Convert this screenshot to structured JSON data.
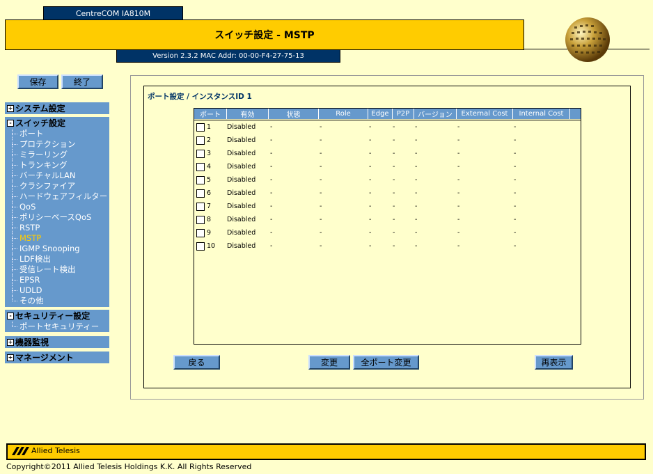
{
  "header": {
    "device_name": "CentreCOM IA810M",
    "title": "スイッチ設定 - MSTP",
    "version_info": "Version 2.3.2 MAC Addr: 00-00-F4-27-75-13"
  },
  "toolbar": {
    "save_label": "保存",
    "exit_label": "終了"
  },
  "sidebar": {
    "system": {
      "label": "システム設定",
      "toggle": "+"
    },
    "switch": {
      "label": "スイッチ設定",
      "toggle": "-",
      "items": [
        "ポート",
        "プロテクション",
        "ミラーリング",
        "トランキング",
        "バーチャルLAN",
        "クラシファイア",
        "ハードウェアフィルター",
        "QoS",
        "ポリシーベースQoS",
        "RSTP",
        "MSTP",
        "IGMP Snooping",
        "LDF検出",
        "受信レート検出",
        "EPSR",
        "UDLD",
        "その他"
      ],
      "active_index": 10
    },
    "security": {
      "label": "セキュリティー設定",
      "toggle": "-",
      "items": [
        "ポートセキュリティー"
      ]
    },
    "monitor": {
      "label": "機器監視",
      "toggle": "+"
    },
    "management": {
      "label": "マネージメント",
      "toggle": "+"
    }
  },
  "main": {
    "section_title": "ポート設定 / インスタンスID 1",
    "columns": [
      "ポート",
      "有効",
      "状態",
      "Role",
      "Edge",
      "P2P",
      "バージョン",
      "External Cost",
      "Internal Cost"
    ],
    "rows": [
      {
        "port": "1",
        "enabled": "Disabled",
        "state": "-",
        "role": "-",
        "edge": "-",
        "p2p": "-",
        "version": "-",
        "ext": "-",
        "int": "-"
      },
      {
        "port": "2",
        "enabled": "Disabled",
        "state": "-",
        "role": "-",
        "edge": "-",
        "p2p": "-",
        "version": "-",
        "ext": "-",
        "int": "-"
      },
      {
        "port": "3",
        "enabled": "Disabled",
        "state": "-",
        "role": "-",
        "edge": "-",
        "p2p": "-",
        "version": "-",
        "ext": "-",
        "int": "-"
      },
      {
        "port": "4",
        "enabled": "Disabled",
        "state": "-",
        "role": "-",
        "edge": "-",
        "p2p": "-",
        "version": "-",
        "ext": "-",
        "int": "-"
      },
      {
        "port": "5",
        "enabled": "Disabled",
        "state": "-",
        "role": "-",
        "edge": "-",
        "p2p": "-",
        "version": "-",
        "ext": "-",
        "int": "-"
      },
      {
        "port": "6",
        "enabled": "Disabled",
        "state": "-",
        "role": "-",
        "edge": "-",
        "p2p": "-",
        "version": "-",
        "ext": "-",
        "int": "-"
      },
      {
        "port": "7",
        "enabled": "Disabled",
        "state": "-",
        "role": "-",
        "edge": "-",
        "p2p": "-",
        "version": "-",
        "ext": "-",
        "int": "-"
      },
      {
        "port": "8",
        "enabled": "Disabled",
        "state": "-",
        "role": "-",
        "edge": "-",
        "p2p": "-",
        "version": "-",
        "ext": "-",
        "int": "-"
      },
      {
        "port": "9",
        "enabled": "Disabled",
        "state": "-",
        "role": "-",
        "edge": "-",
        "p2p": "-",
        "version": "-",
        "ext": "-",
        "int": "-"
      },
      {
        "port": "10",
        "enabled": "Disabled",
        "state": "-",
        "role": "-",
        "edge": "-",
        "p2p": "-",
        "version": "-",
        "ext": "-",
        "int": "-"
      }
    ],
    "buttons": {
      "back": "戻る",
      "change": "変更",
      "change_all": "全ポート変更",
      "refresh": "再表示"
    }
  },
  "footer": {
    "brand": "Allied Telesis",
    "copyright": "Copyright©2011 Allied Telesis Holdings K.K. All Rights Reserved"
  },
  "colors": {
    "background": "#ffffcc",
    "accent_yellow": "#ffcc00",
    "navy": "#003366",
    "sidebar_blue": "#6699cc",
    "active_item": "#ffcc00"
  },
  "icons": {
    "globe": "globe-logo-icon",
    "brand_logo": "allied-telesis-logo-icon"
  }
}
